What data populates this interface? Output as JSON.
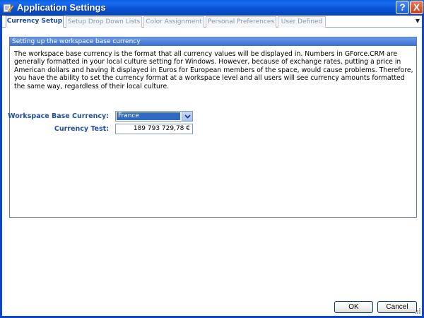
{
  "window": {
    "title": "Application Settings",
    "help_label": "?",
    "close_label": "X"
  },
  "tabs": [
    {
      "label": "Currency Setup",
      "active": true
    },
    {
      "label": "Setup Drop Down Lists",
      "active": false
    },
    {
      "label": "Color Assignment",
      "active": false
    },
    {
      "label": "Personal Preferences",
      "active": false
    },
    {
      "label": "User Defined",
      "active": false
    }
  ],
  "panel": {
    "header": "Setting up the workspace base currency",
    "description": "The workspace base currency is the format that all currency values will be displayed in.  Numbers in GForce.CRM are generally formatted in your local culture setting for Windows.  However, because of exchange rates, putting a price in American dollars and having it displayed in Euros for European members of the space, would cause problems.  Therefore, you have the ability to set the currency format at a workspace level and all users will see currency amounts formatted the same way, regardless of their local culture.",
    "base_currency_label": "Workspace Base Currency:",
    "base_currency_value": "France",
    "currency_test_label": "Currency Test:",
    "currency_test_value": "189 793 729,78 €"
  },
  "buttons": {
    "ok": "OK",
    "cancel": "Cancel"
  },
  "colors": {
    "titlebar": "#0b55d8",
    "active_tab": "#1a4aa0",
    "panel_header": "#3a6ed0",
    "label": "#1f4f9f",
    "selection": "#316ac5"
  },
  "icons": {
    "app": "settings-pencil-icon",
    "help": "help-icon",
    "close": "close-icon",
    "dropdown": "chevron-down-icon",
    "tab_menu": "tab-menu-arrow-icon",
    "grip": "resize-grip-icon"
  }
}
